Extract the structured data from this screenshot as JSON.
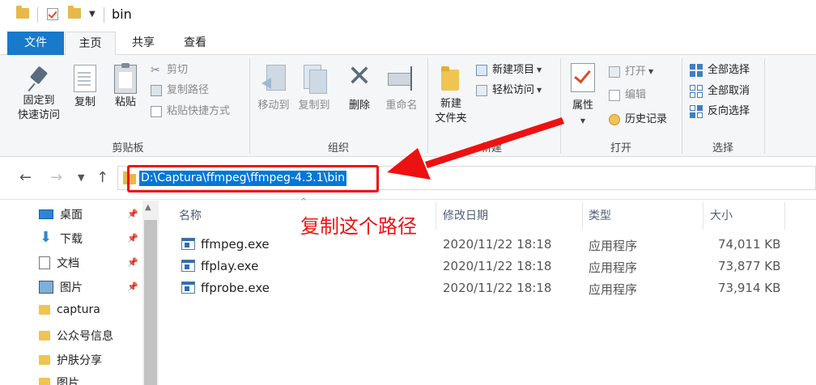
{
  "window": {
    "title": "bin"
  },
  "tabs": [
    {
      "label": "文件"
    },
    {
      "label": "主页"
    },
    {
      "label": "共享"
    },
    {
      "label": "查看"
    }
  ],
  "ribbon": {
    "clipboard": {
      "group_label": "剪贴板",
      "pin_line1": "固定到",
      "pin_line2": "快速访问",
      "copy": "复制",
      "paste": "粘贴",
      "cut": "剪切",
      "copy_path": "复制路径",
      "paste_shortcut": "粘贴快捷方式"
    },
    "organize": {
      "group_label": "组织",
      "move_to": "移动到",
      "copy_to": "复制到",
      "delete": "删除",
      "rename": "重命名"
    },
    "new": {
      "group_label": "新建",
      "new_folder_line1": "新建",
      "new_folder_line2": "文件夹",
      "new_item": "新建项目",
      "easy_access": "轻松访问"
    },
    "open": {
      "group_label": "打开",
      "properties": "属性",
      "open": "打开",
      "edit": "编辑",
      "history": "历史记录"
    },
    "select": {
      "group_label": "选择",
      "select_all": "全部选择",
      "select_none": "全部取消",
      "invert": "反向选择"
    }
  },
  "address": {
    "path": "D:\\Captura\\ffmpeg\\ffmpeg-4.3.1\\bin"
  },
  "annotation": {
    "text": "复制这个路径",
    "color": "#ee1111"
  },
  "nav_pane": {
    "items": [
      {
        "label": "桌面",
        "icon": "desktop-icon",
        "pinned": true
      },
      {
        "label": "下载",
        "icon": "download-icon",
        "pinned": true
      },
      {
        "label": "文档",
        "icon": "documents-icon",
        "pinned": true
      },
      {
        "label": "图片",
        "icon": "pictures-icon",
        "pinned": true
      },
      {
        "label": "captura",
        "icon": "folder-icon",
        "pinned": false
      },
      {
        "label": "公众号信息",
        "icon": "folder-icon",
        "pinned": false
      },
      {
        "label": "护肤分享",
        "icon": "folder-icon",
        "pinned": false
      },
      {
        "label": "图片",
        "icon": "folder-icon",
        "pinned": false
      }
    ]
  },
  "file_list": {
    "columns": [
      {
        "label": "名称"
      },
      {
        "label": "修改日期"
      },
      {
        "label": "类型"
      },
      {
        "label": "大小"
      }
    ],
    "rows": [
      {
        "name": "ffmpeg.exe",
        "date": "2020/11/22 18:18",
        "type": "应用程序",
        "size": "74,011 KB"
      },
      {
        "name": "ffplay.exe",
        "date": "2020/11/22 18:18",
        "type": "应用程序",
        "size": "73,877 KB"
      },
      {
        "name": "ffprobe.exe",
        "date": "2020/11/22 18:18",
        "type": "应用程序",
        "size": "73,914 KB"
      }
    ]
  },
  "colors": {
    "accent": "#1979ca",
    "selection": "#0078d7",
    "folder": "#e8b84a"
  }
}
